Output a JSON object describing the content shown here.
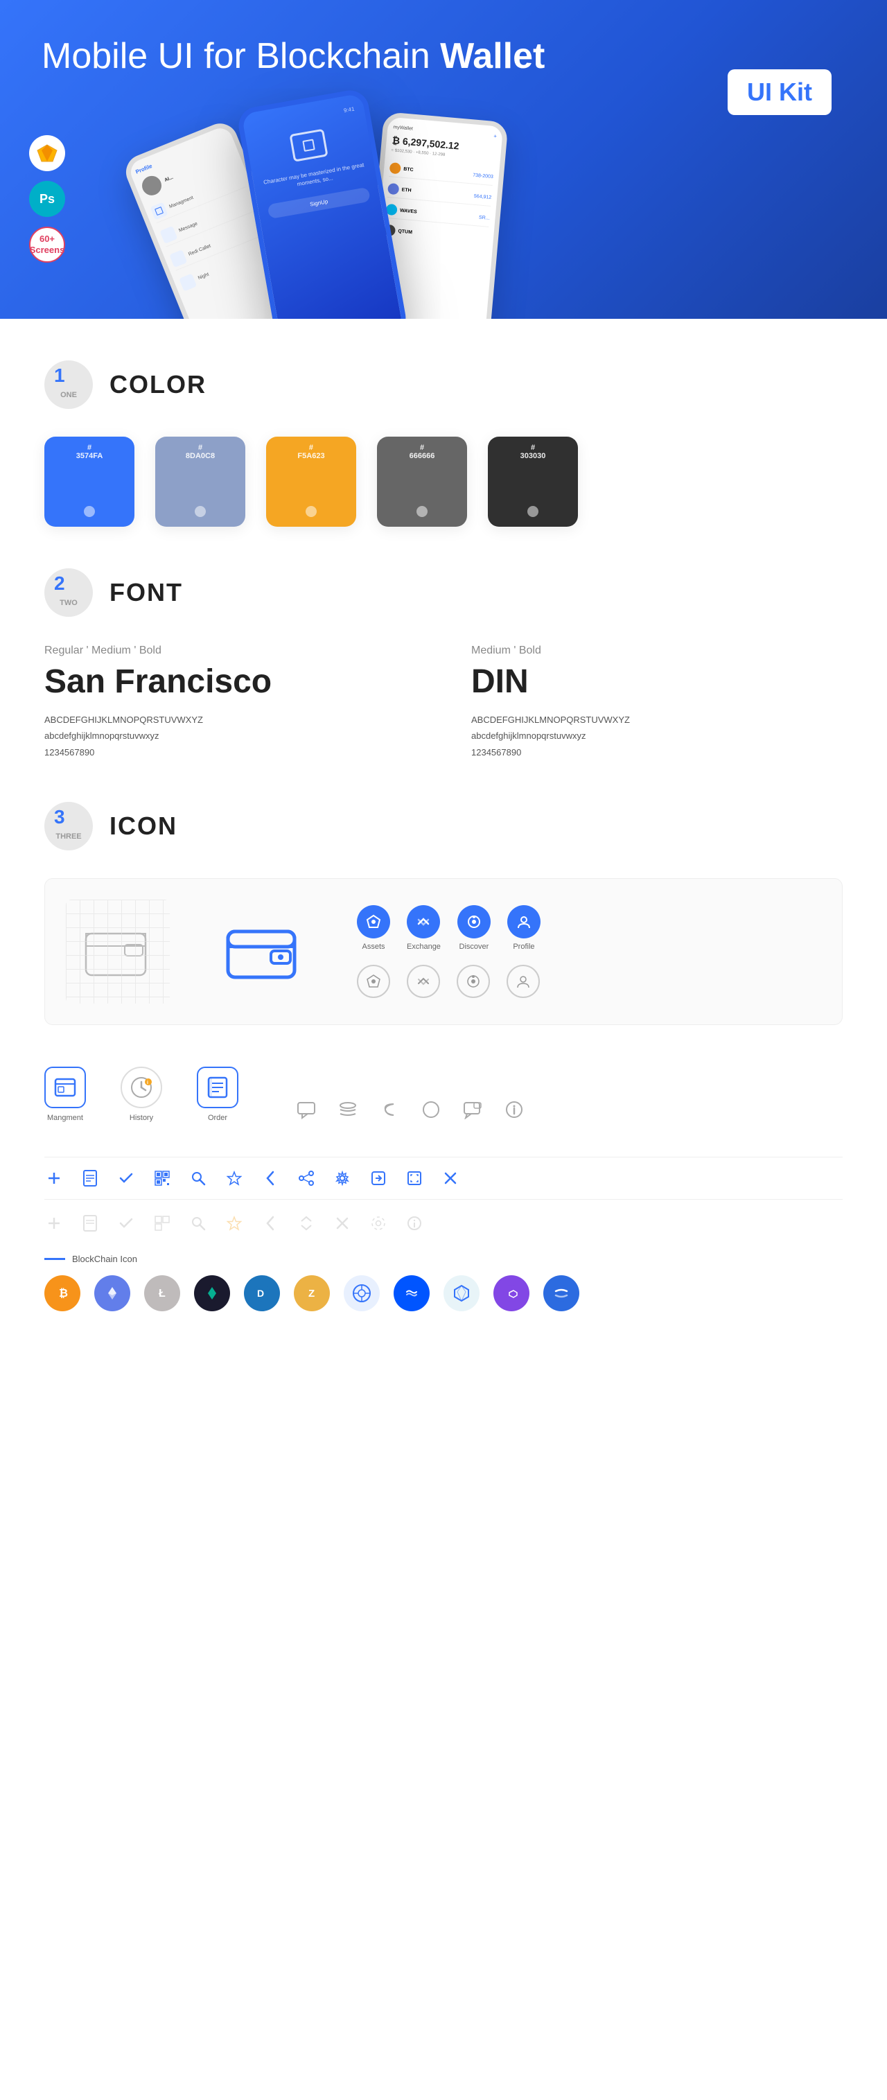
{
  "hero": {
    "title_normal": "Mobile UI for Blockchain ",
    "title_bold": "Wallet",
    "badge": "UI Kit",
    "sketch_icon": "◆",
    "ps_icon": "Ps",
    "screens_badge_line1": "60+",
    "screens_badge_line2": "Screens"
  },
  "sections": {
    "one": {
      "number": "1",
      "word": "ONE",
      "title": "COLOR",
      "swatches": [
        {
          "hex": "#3574FA",
          "code": "#\n3574FA"
        },
        {
          "hex": "#8DA0C8",
          "code": "#\n8DA0C8"
        },
        {
          "hex": "#F5A623",
          "code": "#\nF5A623"
        },
        {
          "hex": "#666666",
          "code": "#\n666666"
        },
        {
          "hex": "#303030",
          "code": "#\n303030"
        }
      ]
    },
    "two": {
      "number": "2",
      "word": "TWO",
      "title": "FONT",
      "font1": {
        "style": "Regular ' Medium ' Bold",
        "name": "San Francisco",
        "upper": "ABCDEFGHIJKLMNOPQRSTUVWXYZ",
        "lower": "abcdefghijklmnopqrstuvwxyz",
        "nums": "1234567890"
      },
      "font2": {
        "style": "Medium ' Bold",
        "name": "DIN",
        "upper": "ABCDEFGHIJKLMNOPQRSTUVWXYZ",
        "lower": "abcdefghijklmnopqrstuvwxyz",
        "nums": "1234567890"
      }
    },
    "three": {
      "number": "3",
      "word": "THREE",
      "title": "ICON",
      "nav_icons": [
        {
          "label": "Assets",
          "color": "#3574FA"
        },
        {
          "label": "Exchange",
          "color": "#3574FA"
        },
        {
          "label": "Discover",
          "color": "#3574FA"
        },
        {
          "label": "Profile",
          "color": "#3574FA"
        }
      ],
      "app_icons": [
        {
          "label": "Mangment"
        },
        {
          "label": "History"
        },
        {
          "label": "Order"
        }
      ],
      "blockchain_label": "BlockChain Icon"
    }
  }
}
